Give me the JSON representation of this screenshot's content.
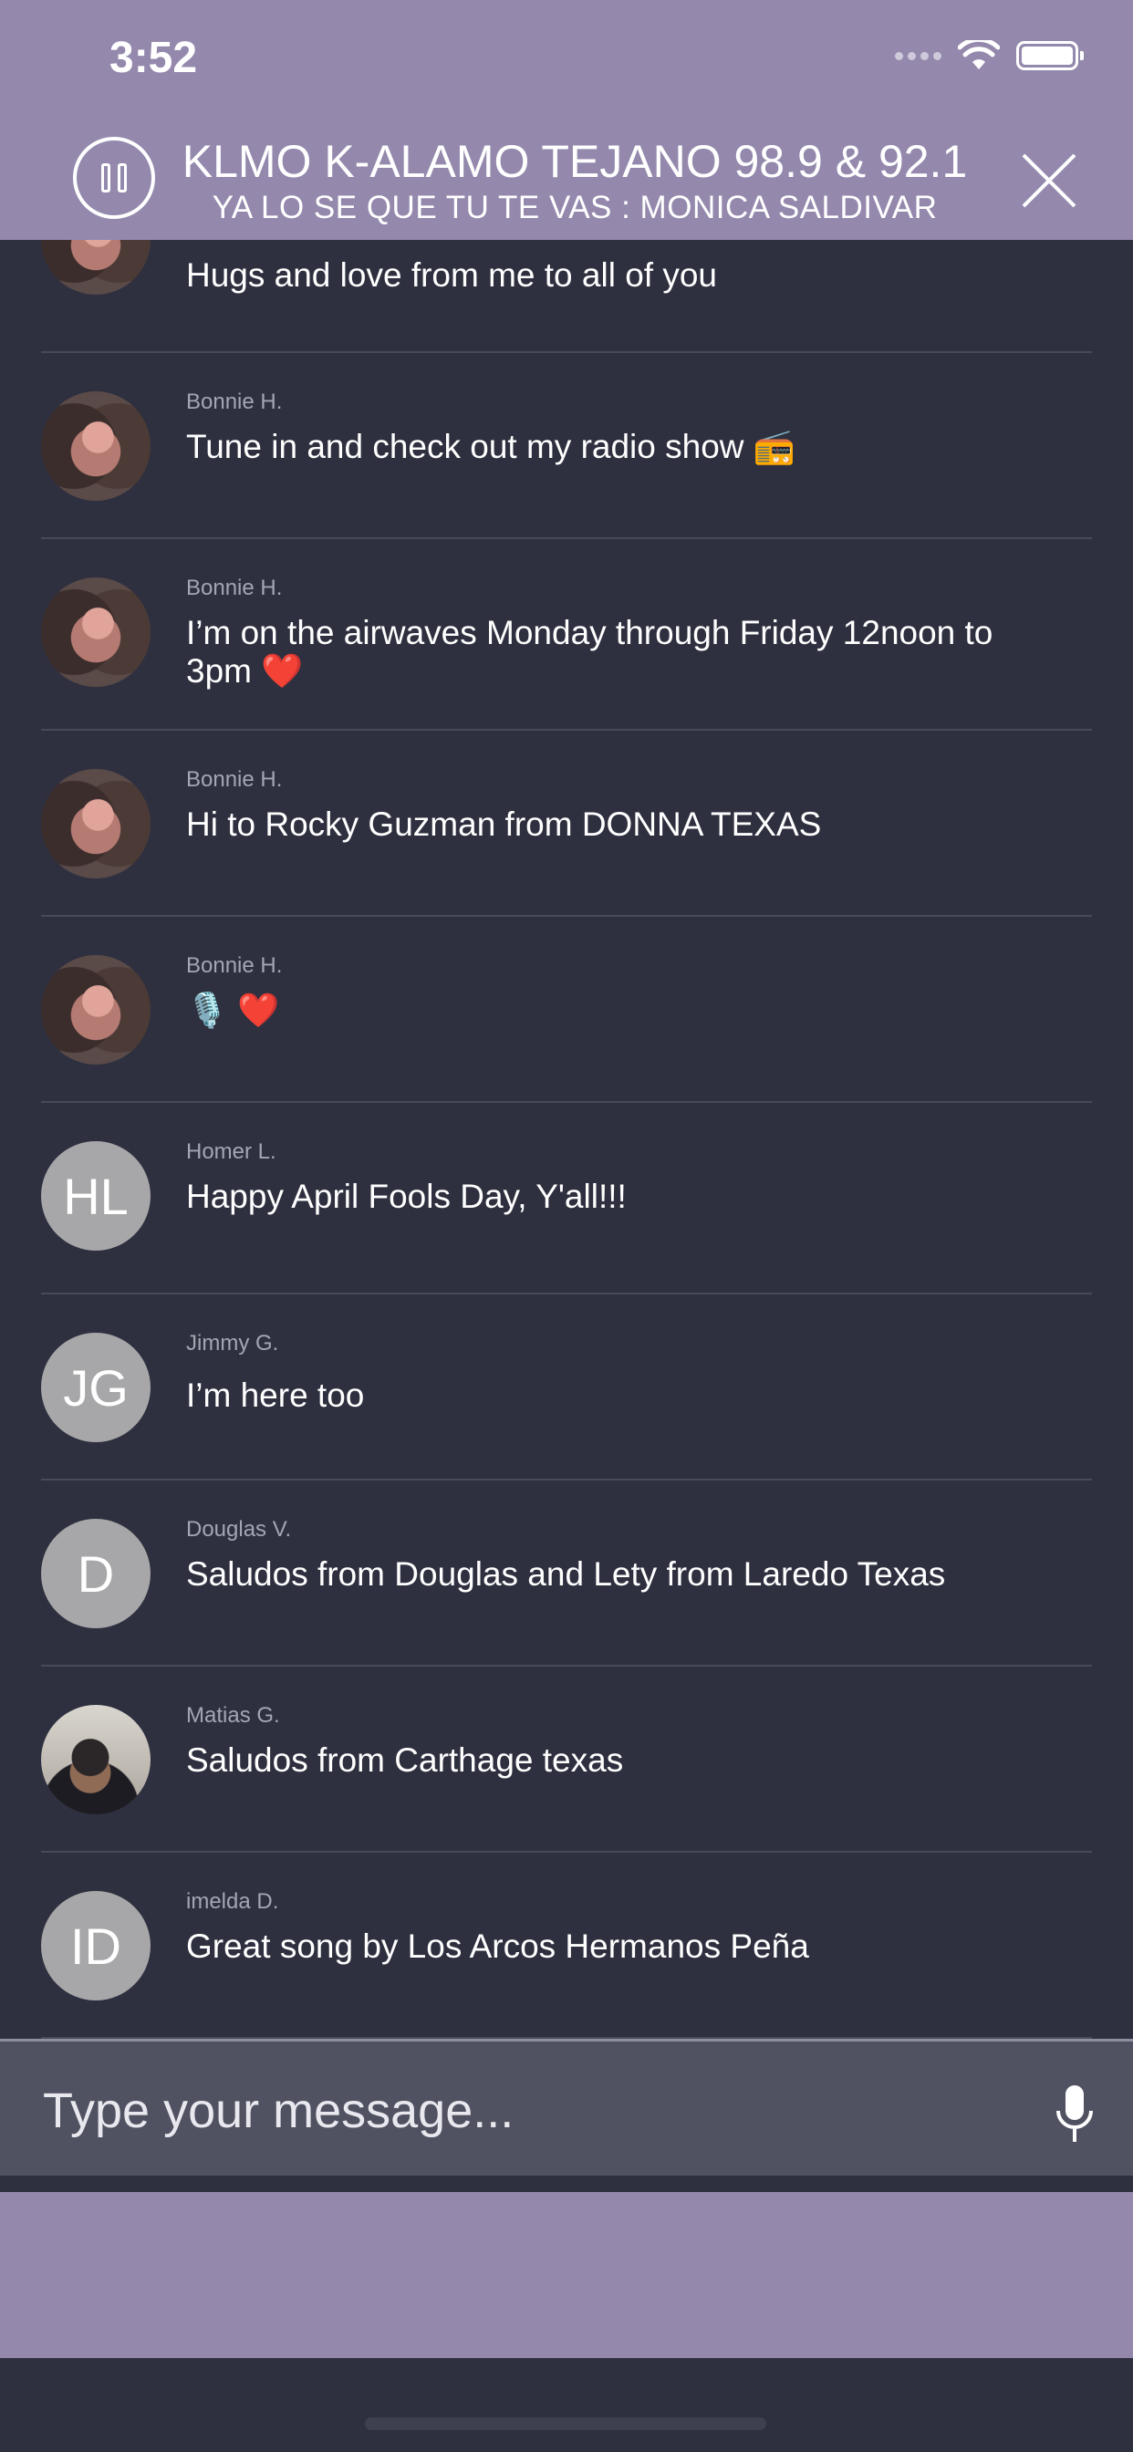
{
  "status_bar": {
    "time": "3:52"
  },
  "player": {
    "station": "KLMO K-ALAMO TEJANO 98.9 & 92.1",
    "song": "YA LO SE QUE TU TE VAS : MONICA SALDIVAR",
    "header_color": "#9489ad"
  },
  "chat": {
    "messages": [
      {
        "author": "",
        "text": "Hugs and love from me to all of you",
        "avatar": "photo"
      },
      {
        "author": "Bonnie H.",
        "text": "Tune in and check out my radio show 📻",
        "avatar": "photo"
      },
      {
        "author": "Bonnie H.",
        "text": "I’m on the airwaves Monday through Friday 12noon to 3pm ❤️",
        "avatar": "photo"
      },
      {
        "author": "Bonnie H.",
        "text": "Hi to Rocky Guzman from DONNA TEXAS",
        "avatar": "photo"
      },
      {
        "author": "Bonnie H.",
        "text": "🎙️ ❤️",
        "avatar": "photo"
      },
      {
        "author": "Homer L.",
        "text": "Happy April Fools Day, Y'all!!!",
        "avatar": "initials",
        "initials": "HL"
      },
      {
        "author": "Jimmy G.",
        "text": "I’m here too",
        "avatar": "initials",
        "initials": "JG"
      },
      {
        "author": "Douglas V.",
        "text": "Saludos from Douglas and Lety from Laredo Texas",
        "avatar": "initials",
        "initials": "D"
      },
      {
        "author": "Matias G.",
        "text": "Saludos from Carthage texas",
        "avatar": "photo2"
      },
      {
        "author": "imelda D.",
        "text": "Great song by Los Arcos Hermanos Peña",
        "avatar": "initials",
        "initials": "ID"
      }
    ]
  },
  "composer": {
    "placeholder": "Type your message..."
  }
}
